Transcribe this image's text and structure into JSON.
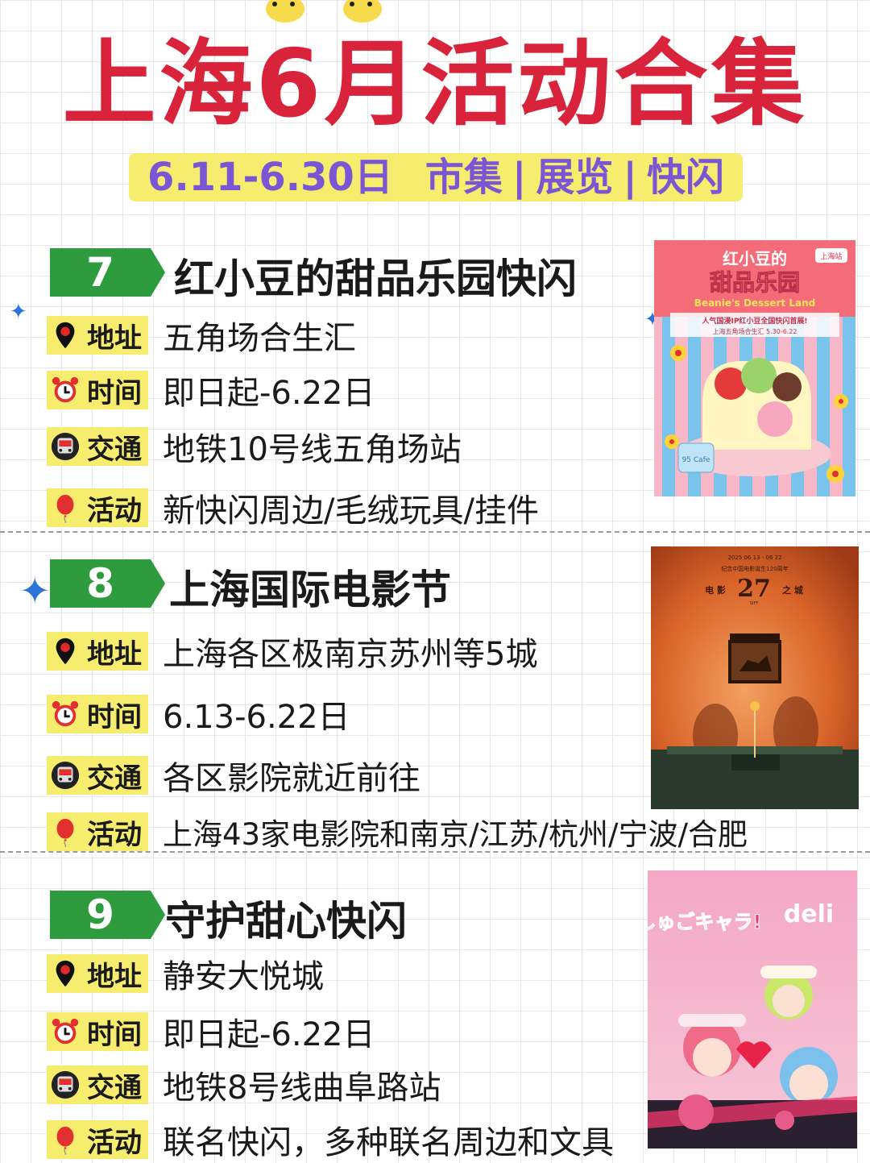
{
  "header": {
    "title": "上海6月活动合集",
    "subtitle_date": "6.11-6.30日",
    "subtitle_tags": [
      "市集",
      "展览",
      "快闪"
    ]
  },
  "labels": {
    "address": "地址",
    "time": "时间",
    "transport": "交通",
    "activity": "活动"
  },
  "sections": [
    {
      "number": "7",
      "title": "红小豆的甜品乐园快闪",
      "address": "五角场合生汇",
      "time": "即日起-6.22日",
      "transport": "地铁10号线五角场站",
      "activity": "新快闪周边/毛绒玩具/挂件",
      "poster": {
        "line1": "红小豆的",
        "line2": "甜品乐园",
        "line3": "Beanie's Dessert Land",
        "line4": "人气国漫IP红小豆全国快闪首展!",
        "line5": "上海五角场合生汇 5.30-6.22",
        "badge": "上海站",
        "cafe": "95 Cafe"
      }
    },
    {
      "number": "8",
      "title": "上海国际电影节",
      "address": "上海各区极南京苏州等5城",
      "time": "6.13-6.22日",
      "transport": "各区影院就近前往",
      "activity": "上海43家电影院和南京/江苏/杭州/宁波/合肥",
      "poster": {
        "dates": "2025 06 13 - 06 22",
        "caption": "纪念中国电影诞生120周年",
        "left": "电  影",
        "edition": "27",
        "right": "之  城",
        "siff": "SIFF"
      }
    },
    {
      "number": "9",
      "title": "守护甜心快闪",
      "address": "静安大悦城",
      "time": "即日起-6.22日",
      "transport": "地铁8号线曲阜路站",
      "activity": "联名快闪，多种联名周边和文具",
      "poster": {
        "logo_left": "しゅごキャラ!",
        "logo_right": "deli"
      }
    }
  ],
  "colors": {
    "title_red": "#d9233a",
    "subtitle_purple": "#7a56d4",
    "highlight_yellow": "#f6ec6e",
    "badge_green": "#2e9b3f"
  }
}
